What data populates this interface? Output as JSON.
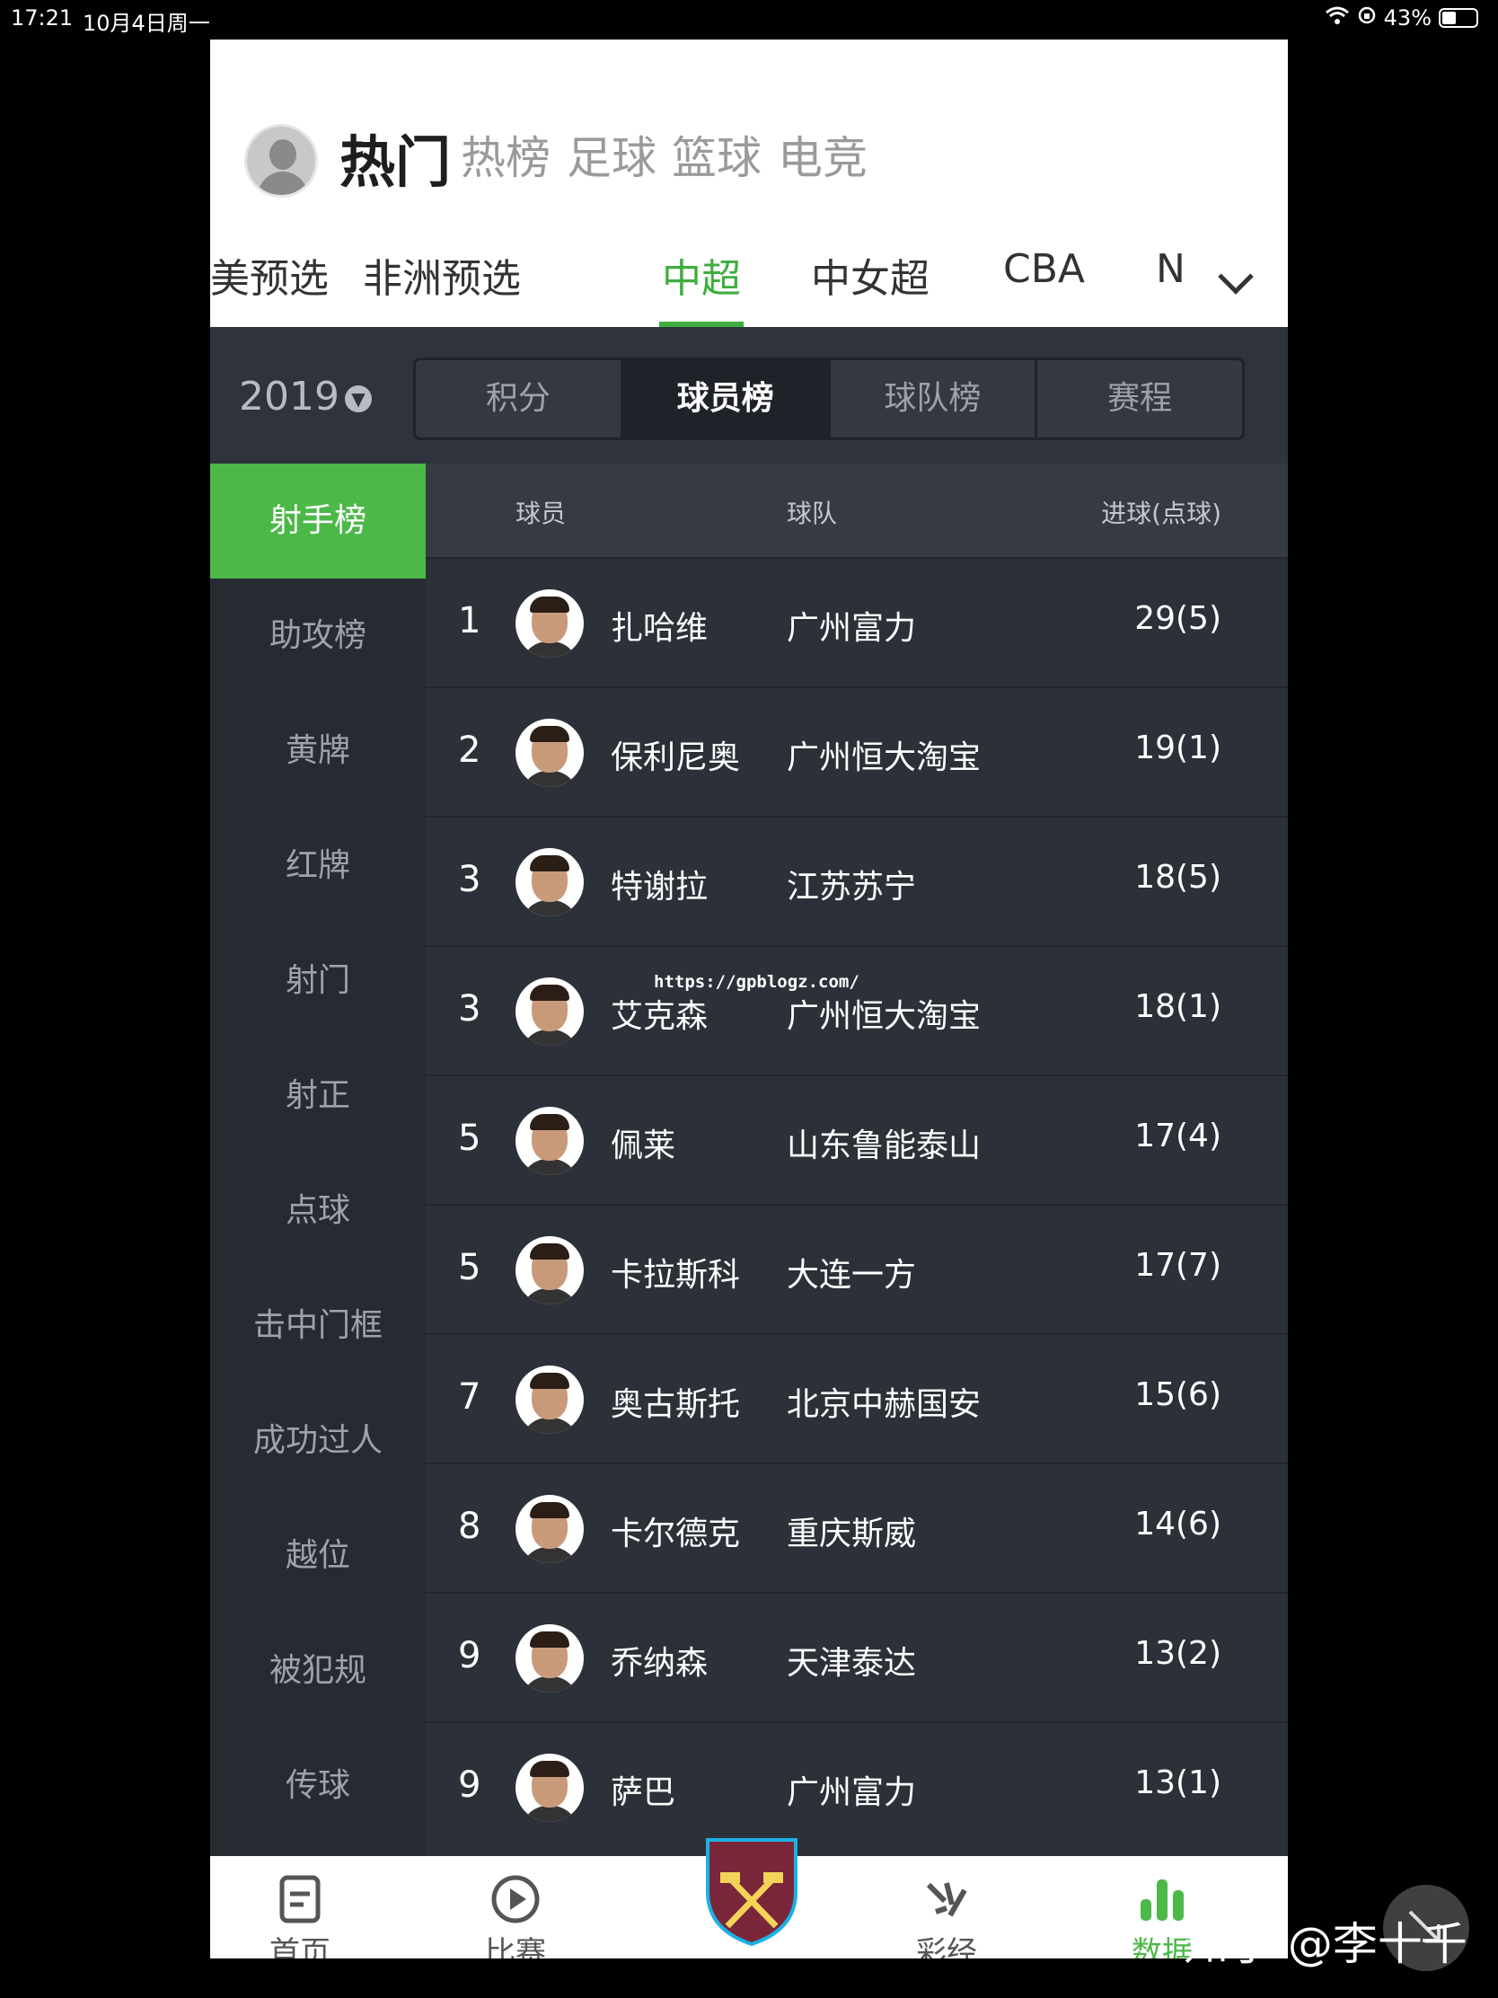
{
  "status": {
    "time": "17:21",
    "date": "10月4日周一",
    "battery": "43%",
    "battery_fraction": 0.43
  },
  "top_tabs": [
    {
      "label": "热门",
      "active": true
    },
    {
      "label": "热榜"
    },
    {
      "label": "足球"
    },
    {
      "label": "篮球"
    },
    {
      "label": "电竞"
    }
  ],
  "league_tabs": [
    {
      "label": "北美预选"
    },
    {
      "label": "非洲预选"
    },
    {
      "label": "中超",
      "active": true
    },
    {
      "label": "中女超"
    },
    {
      "label": "CBA"
    },
    {
      "label": "NBA"
    }
  ],
  "season": {
    "year": "2019"
  },
  "segments": [
    {
      "label": "积分"
    },
    {
      "label": "球员榜",
      "active": true
    },
    {
      "label": "球队榜"
    },
    {
      "label": "赛程"
    }
  ],
  "side_menu": [
    {
      "label": "射手榜",
      "active": true
    },
    {
      "label": "助攻榜"
    },
    {
      "label": "黄牌"
    },
    {
      "label": "红牌"
    },
    {
      "label": "射门"
    },
    {
      "label": "射正"
    },
    {
      "label": "点球"
    },
    {
      "label": "击中门框"
    },
    {
      "label": "成功过人"
    },
    {
      "label": "越位"
    },
    {
      "label": "被犯规"
    },
    {
      "label": "传球"
    }
  ],
  "table": {
    "headers": {
      "player": "球员",
      "team": "球队",
      "goals": "进球(点球)"
    },
    "rows": [
      {
        "rank": "1",
        "name": "扎哈维",
        "team": "广州富力",
        "goals": "29(5)"
      },
      {
        "rank": "2",
        "name": "保利尼奥",
        "team": "广州恒大淘宝",
        "goals": "19(1)"
      },
      {
        "rank": "3",
        "name": "特谢拉",
        "team": "江苏苏宁",
        "goals": "18(5)"
      },
      {
        "rank": "3",
        "name": "艾克森",
        "team": "广州恒大淘宝",
        "goals": "18(1)"
      },
      {
        "rank": "5",
        "name": "佩莱",
        "team": "山东鲁能泰山",
        "goals": "17(4)"
      },
      {
        "rank": "5",
        "name": "卡拉斯科",
        "team": "大连一方",
        "goals": "17(7)"
      },
      {
        "rank": "7",
        "name": "奥古斯托",
        "team": "北京中赫国安",
        "goals": "15(6)"
      },
      {
        "rank": "8",
        "name": "卡尔德克",
        "team": "重庆斯威",
        "goals": "14(6)"
      },
      {
        "rank": "9",
        "name": "乔纳森",
        "team": "天津泰达",
        "goals": "13(2)"
      },
      {
        "rank": "9",
        "name": "萨巴",
        "team": "广州富力",
        "goals": "13(1)"
      }
    ]
  },
  "overlay_url": "https://gpblogz.com/",
  "bottom_nav": [
    {
      "label": "首页",
      "icon": "document-icon"
    },
    {
      "label": "比赛",
      "icon": "play-circle-icon"
    },
    {
      "label": "",
      "icon": "west-ham-crest-icon"
    },
    {
      "label": "彩经",
      "icon": "tools-icon"
    },
    {
      "label": "数据",
      "icon": "bar-chart-icon",
      "active": true
    }
  ],
  "watermark": "知乎 @李十千",
  "colors": {
    "accent": "#4cb848",
    "dark_bg": "#2c3038"
  }
}
